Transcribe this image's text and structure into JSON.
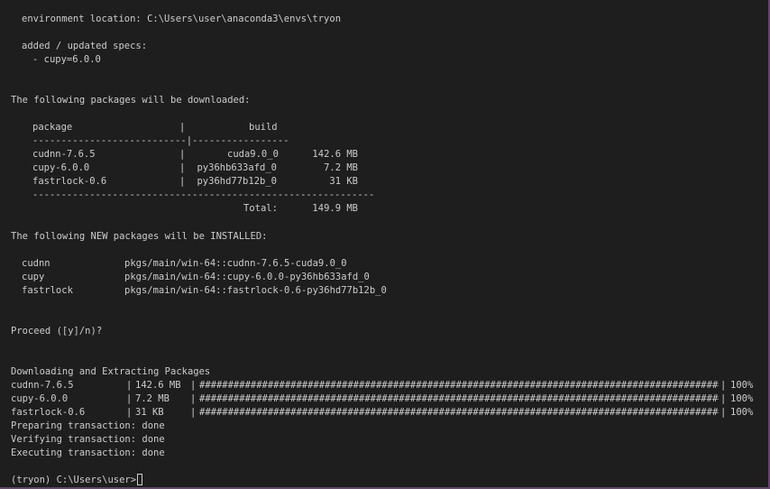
{
  "env": {
    "location_label": "environment location:",
    "location_path": "C:\\Users\\user\\anaconda3\\envs\\tryon",
    "specs_title": "added / updated specs:",
    "spec": "- cupy=6.0.0"
  },
  "download": {
    "title": "The following packages will be downloaded:",
    "header_package": "package",
    "header_build": "build",
    "sep_left": "---------------------------",
    "sep_right": "-----------------",
    "rows": [
      {
        "package": "cudnn-7.6.5",
        "build": "cuda9.0_0",
        "size": "142.6 MB"
      },
      {
        "package": "cupy-6.0.0",
        "build": "py36hb633afd_0",
        "size": "7.2 MB"
      },
      {
        "package": "fastrlock-0.6",
        "build": "py36hd77b12b_0",
        "size": "31 KB"
      }
    ],
    "sep_full": "------------------------------------------------------------",
    "total_label": "Total:",
    "total_value": "149.9 MB"
  },
  "install": {
    "title": "The following NEW packages will be INSTALLED:",
    "rows": [
      {
        "name": "cudnn",
        "spec": "pkgs/main/win-64::cudnn-7.6.5-cuda9.0_0"
      },
      {
        "name": "cupy",
        "spec": "pkgs/main/win-64::cupy-6.0.0-py36hb633afd_0"
      },
      {
        "name": "fastrlock",
        "spec": "pkgs/main/win-64::fastrlock-0.6-py36hd77b12b_0"
      }
    ]
  },
  "prompt_proceed": "Proceed ([y]/n)?",
  "extract": {
    "title": "Downloading and Extracting Packages",
    "rows": [
      {
        "name": "cudnn-7.6.5",
        "size": "142.6 MB",
        "progress": 100,
        "percent": "100%"
      },
      {
        "name": "cupy-6.0.0",
        "size": "7.2 MB",
        "progress": 100,
        "percent": "100%"
      },
      {
        "name": "fastrlock-0.6",
        "size": "31 KB",
        "progress": 100,
        "percent": "100%"
      }
    ],
    "bar_text": "####################################################################################################"
  },
  "transactions": [
    "Preparing transaction: done",
    "Verifying transaction: done",
    "Executing transaction: done"
  ],
  "final_prompt": "(tryon) C:\\Users\\user>"
}
